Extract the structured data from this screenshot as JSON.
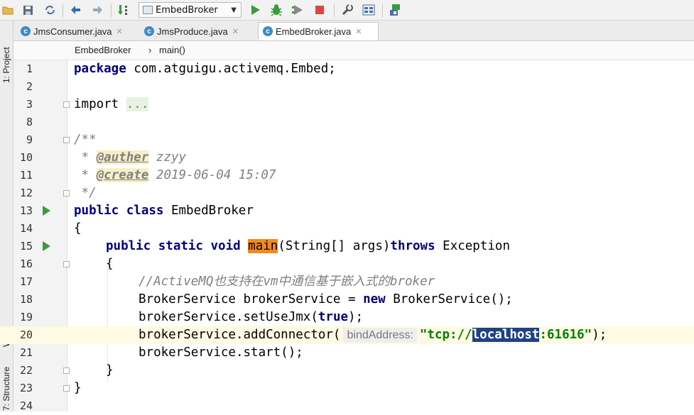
{
  "toolbar": {
    "run_config": "EmbedBroker",
    "icons": [
      "open-folder-icon",
      "save-icon",
      "sync-icon",
      "back-icon",
      "forward-icon",
      "build-icon",
      "run-config-icon",
      "run-icon",
      "debug-icon",
      "coverage-icon",
      "stop-icon",
      "project-structure-icon",
      "sdk-icon",
      "vcs-icon"
    ],
    "colors": {
      "run": "#3a9b3a",
      "stop": "#d9463b",
      "debug": "#3a9b3a"
    }
  },
  "left_tool_strip": {
    "project": "1: Project",
    "web": "Web",
    "structure": "7: Structure"
  },
  "tabs": [
    {
      "label": "JmsConsumer.java",
      "active": false
    },
    {
      "label": "JmsProduce.java",
      "active": false
    },
    {
      "label": "EmbedBroker.java",
      "active": true
    }
  ],
  "breadcrumb": {
    "class_name": "EmbedBroker",
    "separator": "›",
    "method_name": "main()"
  },
  "editor": {
    "current_line": "20",
    "lines": [
      {
        "n": "1",
        "package_kw": "package",
        "package_name": " com.atguigu.activemq.Embed;"
      },
      {
        "n": "2"
      },
      {
        "n": "3",
        "import_kw": "import",
        "folded": "..."
      },
      {
        "n": "8"
      },
      {
        "n": "9",
        "text": "/**"
      },
      {
        "n": "10",
        "star": " * ",
        "tag": "@auther",
        "value": " zzyy"
      },
      {
        "n": "11",
        "star": " * ",
        "tag": "@create",
        "value": " 2019-06-04 15:07"
      },
      {
        "n": "12",
        "text": " */"
      },
      {
        "n": "13",
        "kw": "public class",
        "rest": " EmbedBroker"
      },
      {
        "n": "14",
        "text": "{"
      },
      {
        "n": "15",
        "kw": "public static void",
        "method": "main",
        "rest": "(String[] args)",
        "throws_kw": "throws",
        "exc": " Exception"
      },
      {
        "n": "16",
        "text": "{"
      },
      {
        "n": "17",
        "comment": "//ActiveMQ也支持在vm中通信基于嵌入式的broker"
      },
      {
        "n": "18",
        "a": "BrokerService brokerService = ",
        "new_kw": "new",
        "b": " BrokerService();"
      },
      {
        "n": "19",
        "a": "brokerService.setUseJmx(",
        "true_kw": "true",
        "b": ");"
      },
      {
        "n": "20",
        "a": "brokerService.addConnector(",
        "hint": "bindAddress:",
        "s1": "\"tcp://",
        "sel": "localhost",
        "s2": ":61616\"",
        "b": ");"
      },
      {
        "n": "21",
        "text": "brokerService.start();"
      },
      {
        "n": "22",
        "text": "}"
      },
      {
        "n": "23",
        "text": "}"
      },
      {
        "n": "24"
      }
    ]
  }
}
